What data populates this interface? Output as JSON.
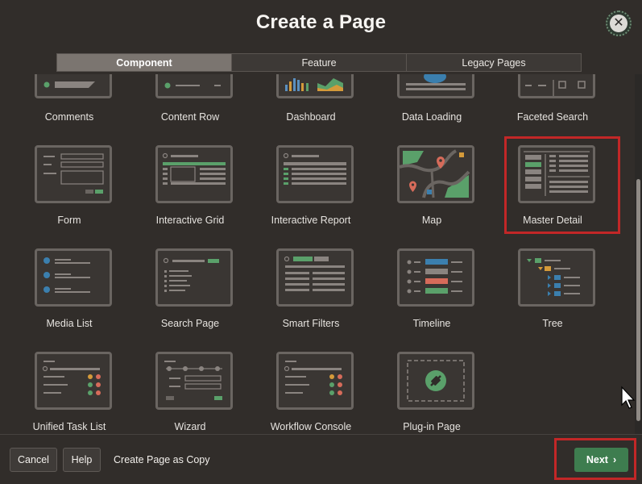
{
  "dialog": {
    "title": "Create a Page",
    "close_icon": "close-icon"
  },
  "tabs": [
    {
      "label": "Component",
      "active": true
    },
    {
      "label": "Feature",
      "active": false
    },
    {
      "label": "Legacy Pages",
      "active": false
    }
  ],
  "tiles": {
    "comments": "Comments",
    "content_row": "Content Row",
    "dashboard": "Dashboard",
    "data_loading": "Data Loading",
    "faceted_search": "Faceted Search",
    "form": "Form",
    "interactive_grid": "Interactive Grid",
    "interactive_report": "Interactive Report",
    "map": "Map",
    "master_detail": "Master Detail",
    "media_list": "Media List",
    "search_page": "Search Page",
    "smart_filters": "Smart Filters",
    "timeline": "Timeline",
    "tree": "Tree",
    "unified_task_list": "Unified Task List",
    "wizard": "Wizard",
    "workflow_console": "Workflow Console",
    "plugin_page": "Plug-in Page"
  },
  "selected_tile": "Master Detail",
  "footer": {
    "cancel": "Cancel",
    "help": "Help",
    "copy": "Create Page as Copy",
    "next": "Next",
    "next_icon": "chevron-right-icon"
  },
  "colors": {
    "accent_green": "#3e7d4f",
    "highlight_red": "#c22727",
    "active_tab": "#7b7570"
  }
}
